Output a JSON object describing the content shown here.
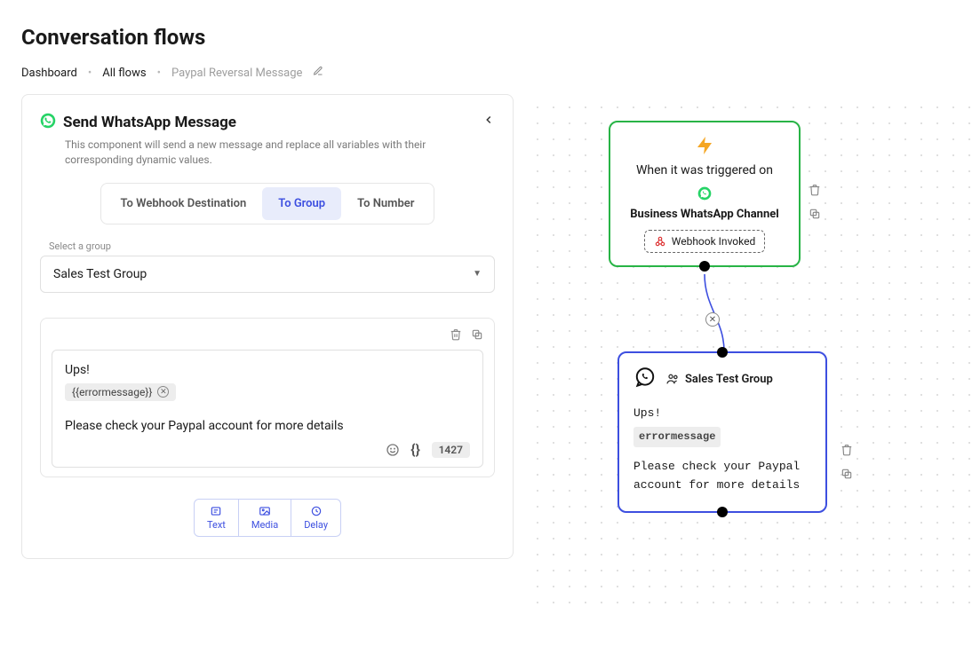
{
  "page": {
    "title": "Conversation flows",
    "breadcrumb": {
      "root": "Dashboard",
      "mid": "All flows",
      "current": "Paypal Reversal Message"
    }
  },
  "panel": {
    "title": "Send WhatsApp Message",
    "desc": "This component will send a new message and replace all variables with their corresponding dynamic values.",
    "tabs": {
      "webhook": "To Webhook Destination",
      "group": "To Group",
      "number": "To Number",
      "active": "group"
    },
    "selectLabel": "Select a group",
    "selectValue": "Sales Test Group",
    "editor": {
      "line1": "Ups!",
      "chip": "{{errormessage}}",
      "body": "Please check your Paypal account for more details",
      "counter": "1427"
    },
    "bottomTabs": {
      "text": "Text",
      "media": "Media",
      "delay": "Delay"
    }
  },
  "trigger": {
    "line1": "When it was triggered on",
    "line2": "Business WhatsApp Channel",
    "chip": "Webhook Invoked"
  },
  "msgNode": {
    "group": "Sales Test Group",
    "line1": "Ups!",
    "var": "errormessage",
    "body": "Please check your Paypal account for more details"
  }
}
